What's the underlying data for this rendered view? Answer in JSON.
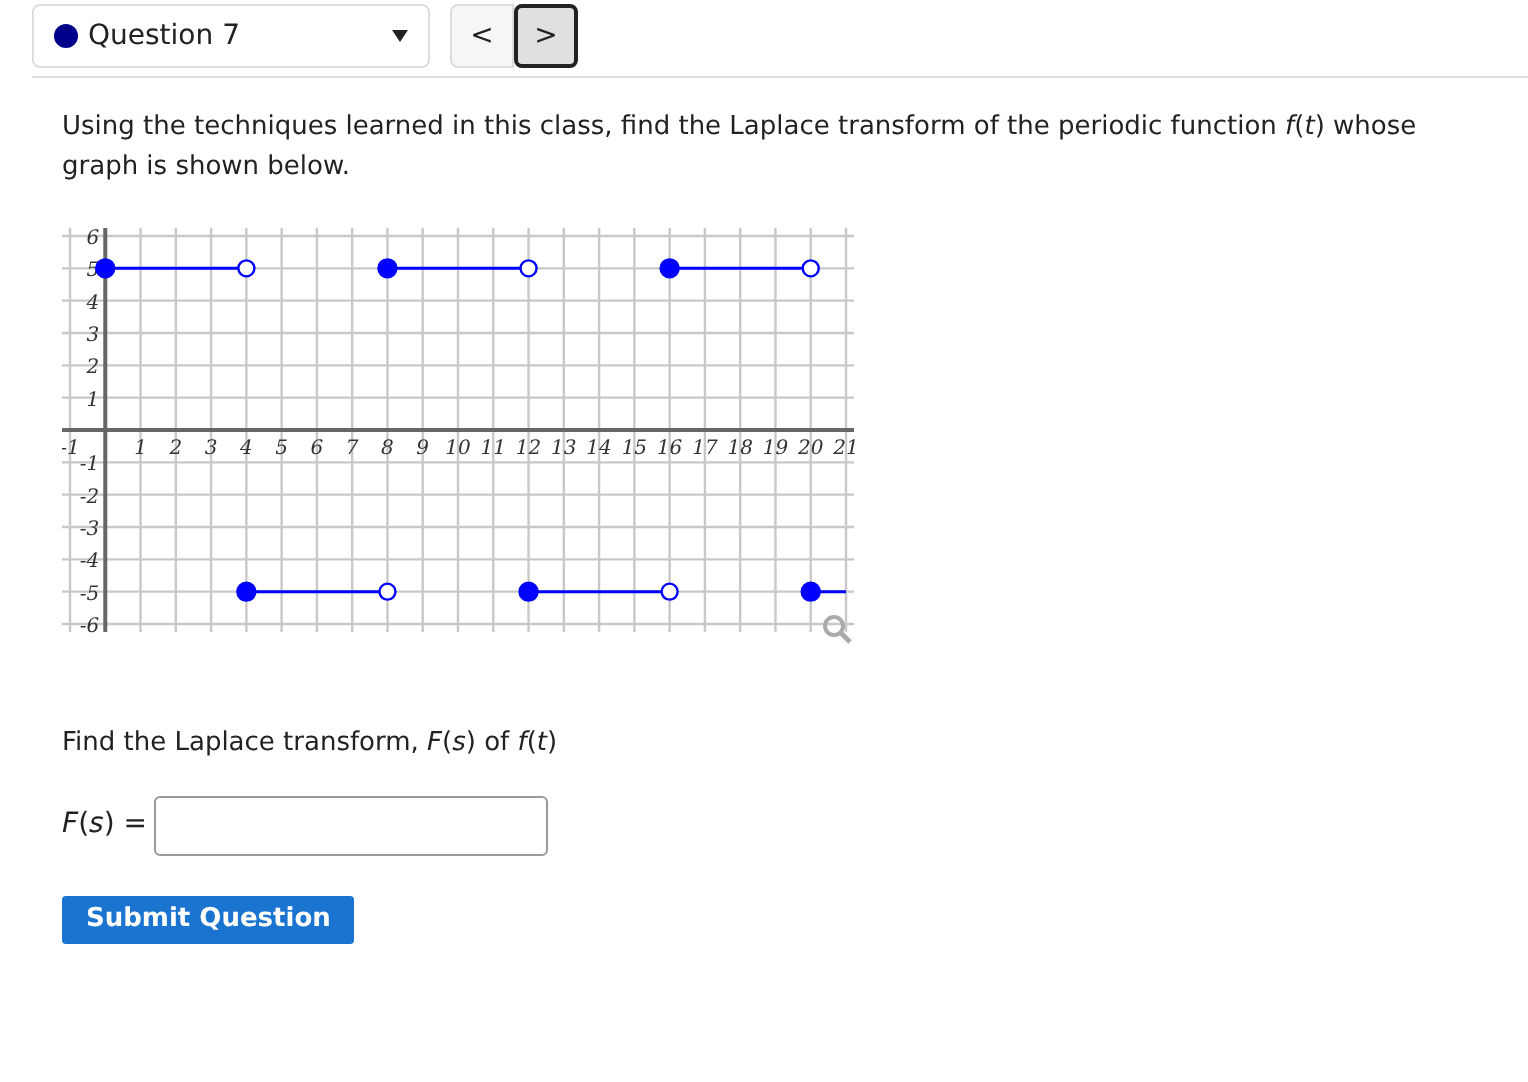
{
  "question_select": {
    "label": "Question 7",
    "color": "#00008b"
  },
  "nav": {
    "prev": "<",
    "next": ">"
  },
  "prompt": "Using the techniques learned in this class, find the Laplace transform of the periodic function *f*(*t*) whose graph is shown below.",
  "chart_data": {
    "type": "line",
    "grid": true,
    "x": [
      0,
      1,
      2,
      3,
      4,
      5,
      6,
      7,
      8,
      9,
      10,
      11,
      12,
      13,
      14,
      15,
      16,
      17,
      18,
      19,
      20,
      21
    ],
    "xlim": [
      -1,
      21
    ],
    "ylim": [
      -6,
      6
    ],
    "xticks": [
      -1,
      1,
      2,
      3,
      4,
      5,
      6,
      7,
      8,
      9,
      10,
      11,
      12,
      13,
      14,
      15,
      16,
      17,
      18,
      19,
      20,
      21
    ],
    "yticks": [
      -6,
      -5,
      -4,
      -3,
      -2,
      -1,
      1,
      2,
      3,
      4,
      5,
      6
    ],
    "series": [
      {
        "color": "#0000ff",
        "values": [
          5,
          5,
          5,
          5,
          5,
          null,
          null,
          null,
          5,
          5,
          5,
          5,
          5,
          null,
          null,
          null,
          5,
          5,
          5,
          5,
          5,
          null
        ]
      },
      {
        "color": "#0000ff",
        "values": [
          null,
          null,
          null,
          null,
          -5,
          -5,
          -5,
          -5,
          -5,
          null,
          null,
          null,
          -5,
          -5,
          -5,
          -5,
          -5,
          null,
          null,
          null,
          -5,
          -5
        ]
      }
    ]
  },
  "find_text": "Find the Laplace transform, *F*(*s*) of *f*(*t*)",
  "answer": {
    "label": "*F*(*s*) ="
  },
  "submit": "Submit Question"
}
